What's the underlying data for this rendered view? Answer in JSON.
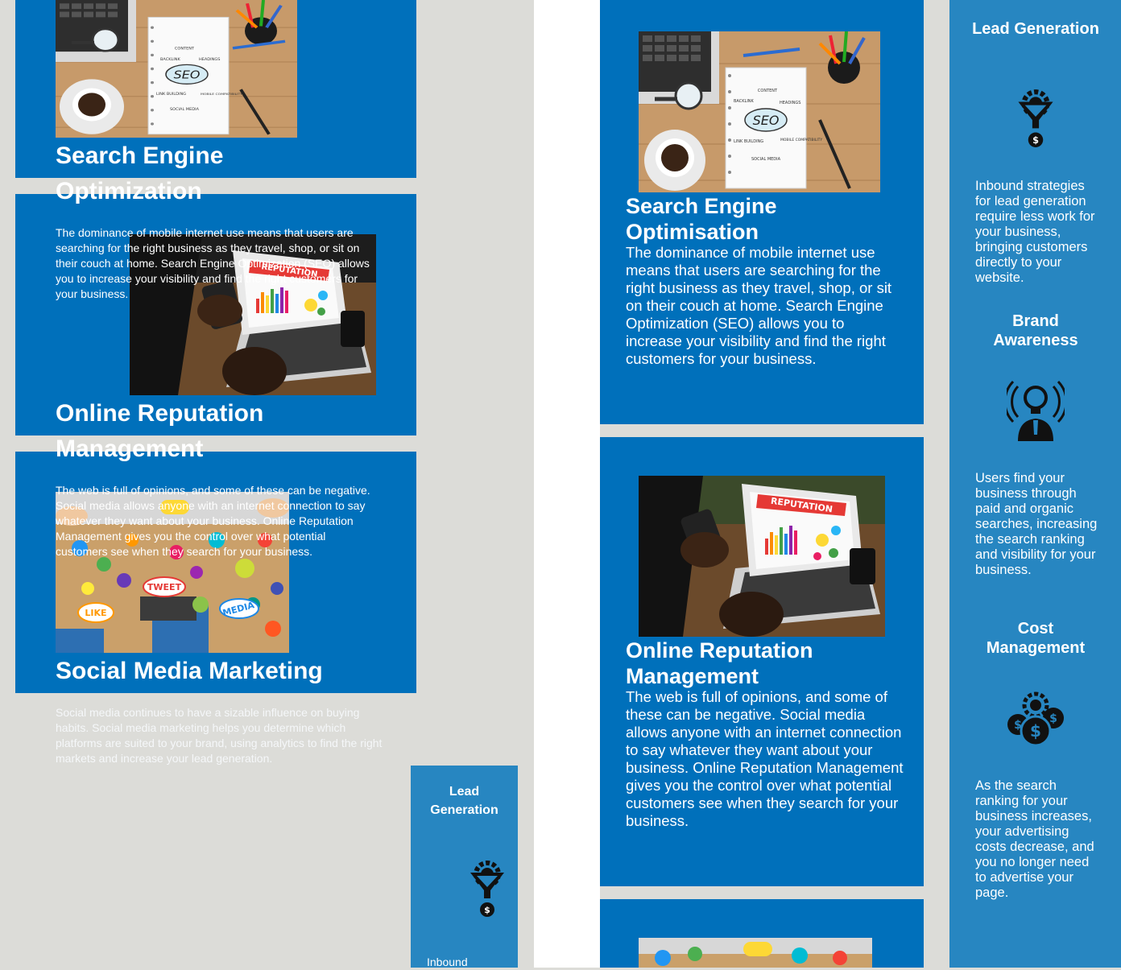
{
  "left_column": {
    "seo": {
      "title": "Search Engine Optimization",
      "body": "The dominance of mobile internet use means that users are searching for the right business as they travel, shop, or sit on their couch at home. Search Engine Optimization (SEO) allows you to increase your visibility and find the right customers for your business."
    },
    "reputation": {
      "title": "Online Reputation Management",
      "body": "The web is full of opinions, and some of these can be negative. Social media allows anyone with an internet connection to say whatever they want about your business. Online Reputation Management gives you the control over what potential customers see when they search for your business."
    },
    "social": {
      "title": "Social Media Marketing",
      "body": "Social media continues to have a sizable influence on buying habits. Social media marketing helps you determine which platforms are suited to your brand, using analytics to find the right markets and increase your lead generation."
    },
    "lead_card": {
      "title": "Lead Generation",
      "body": "Inbound"
    }
  },
  "middle_column": {
    "seo": {
      "title": "Search Engine Optimisation",
      "body": "The dominance of mobile internet use means that users are searching for the right business as they travel, shop, or sit on their couch at home. Search Engine Optimization (SEO) allows you to increase your visibility and find the right customers for your business."
    },
    "reputation": {
      "title": "Online Reputation Management",
      "body": "The web is full of opinions, and some of these can be negative. Social media allows anyone with an internet connection to say whatever they want about your business. Online Reputation Management gives you the control over what potential customers see when they search for your business."
    }
  },
  "right_column": {
    "lead": {
      "title": "Lead Generation",
      "icon": "funnel-gear-icon",
      "body": "Inbound strategies for lead generation require less work for your business, bringing customers directly to your website."
    },
    "brand": {
      "title": "Brand Awareness",
      "icon": "lightbulb-person-icon",
      "body": "Users find your business through paid and organic searches, increasing the search ranking and visibility for your business."
    },
    "cost": {
      "title": "Cost Management",
      "icon": "coins-gear-icon",
      "body": "As the search ranking for your business increases, your advertising costs decrease, and you no longer need to advertise your page."
    }
  },
  "seo_notebook": {
    "center": "SEO",
    "labels": [
      "CONTENT",
      "BACKLINK",
      "HEADINGS",
      "LINK BUILDING",
      "MOBILE COMPATIBILITY",
      "SOCIAL MEDIA"
    ]
  },
  "reputation_screen": {
    "banner": "REPUTATION"
  },
  "social_collage": {
    "words": [
      "LIKE",
      "TWEET",
      "MEDIA"
    ]
  },
  "colors": {
    "page_background": "#dcdcd8",
    "card_blue": "#0070bb",
    "panel_blue": "#2786c1",
    "text": "#ffffff",
    "gap": "#ffffff"
  }
}
